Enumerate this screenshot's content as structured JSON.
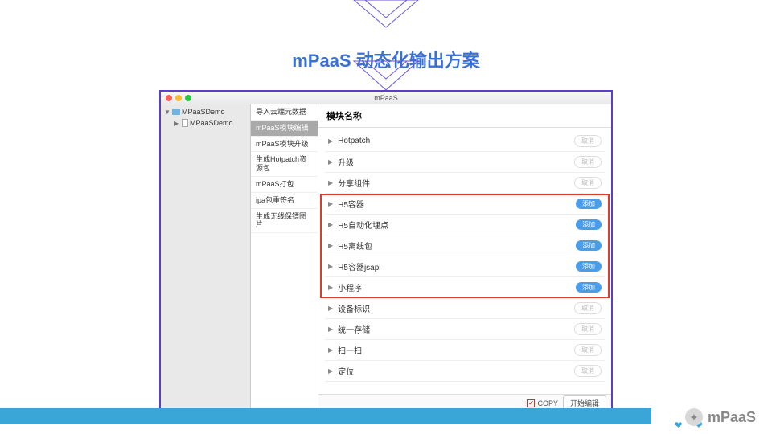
{
  "title": "mPaaS 动态化输出方案",
  "window_title": "mPaaS",
  "tree": {
    "root": "MPaaSDemo",
    "child": "MPaaSDemo"
  },
  "menu": [
    "导入云端元数据",
    "mPaaS模块编辑",
    "mPaaS模块升级",
    "生成Hotpatch资源包",
    "mPaaS打包",
    "ipa包重签名",
    "生成无线保镖图片"
  ],
  "menu_active_index": 1,
  "content_header": "模块名称",
  "pill_labels": {
    "gray": "取消",
    "blue": "添加"
  },
  "modules": [
    {
      "name": "Hotpatch",
      "state": "gray"
    },
    {
      "name": "升级",
      "state": "gray"
    },
    {
      "name": "分享组件",
      "state": "gray"
    },
    {
      "name": "H5容器",
      "state": "blue"
    },
    {
      "name": "H5自动化埋点",
      "state": "blue"
    },
    {
      "name": "H5离线包",
      "state": "blue"
    },
    {
      "name": "H5容器jsapi",
      "state": "blue"
    },
    {
      "name": "小程序",
      "state": "blue"
    },
    {
      "name": "设备标识",
      "state": "gray"
    },
    {
      "name": "统一存储",
      "state": "gray"
    },
    {
      "name": "扫一扫",
      "state": "gray"
    },
    {
      "name": "定位",
      "state": "gray"
    }
  ],
  "highlight_range": [
    3,
    7
  ],
  "footer": {
    "checkbox": "COPY",
    "checked": true,
    "button": "开始编辑"
  },
  "watermark": "mPaaS"
}
